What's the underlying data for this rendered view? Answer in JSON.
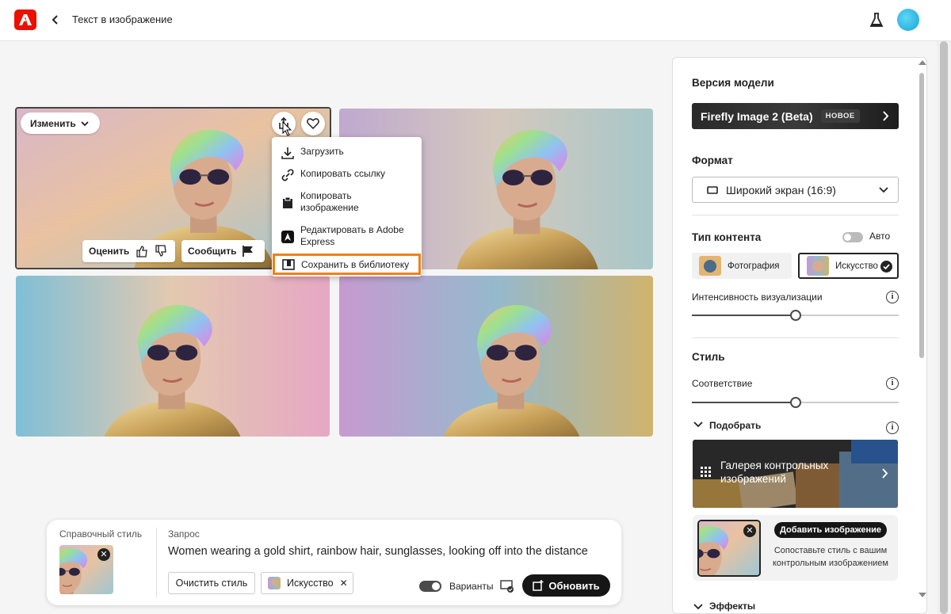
{
  "header": {
    "title": "Текст в изображение"
  },
  "image_actions": {
    "edit_label": "Изменить",
    "rate_label": "Оценить",
    "report_label": "Сообщить"
  },
  "share_menu": {
    "items": [
      {
        "label": "Загрузить",
        "icon": "download-icon"
      },
      {
        "label": "Копировать ссылку",
        "icon": "link-icon"
      },
      {
        "label": "Копировать изображение",
        "icon": "clipboard-icon"
      },
      {
        "label": "Редактировать в Adobe Express",
        "icon": "adobe-express-icon"
      },
      {
        "label": "Сохранить в библиотеку",
        "icon": "library-icon"
      }
    ]
  },
  "prompt_bar": {
    "ref_style_label": "Справочный стиль",
    "prompt_label": "Запрос",
    "prompt_text": "Women wearing a gold shirt, rainbow hair, sunglasses, looking off into the distance",
    "clear_style_label": "Очистить стиль",
    "tag_label": "Искусство",
    "variants_label": "Варианты",
    "update_label": "Обновить"
  },
  "panel": {
    "model_heading": "Версия модели",
    "model_name": "Firefly Image 2 (Beta)",
    "model_badge": "НОВОЕ",
    "format_heading": "Формат",
    "format_value": "Широкий экран (16:9)",
    "content_type_heading": "Тип контента",
    "auto_label": "Авто",
    "content_types": [
      "Фотография",
      "Искусство"
    ],
    "selected_content_type": "Искусство",
    "intensity_label": "Интенсивность визуализации",
    "intensity_value": 0.5,
    "style_heading": "Стиль",
    "match_label": "Соответствие",
    "match_value": 0.5,
    "pick_label": "Подобрать",
    "gallery_label": "Галерея контрольных изображений",
    "add_image_label": "Добавить изображение",
    "ref_description": "Сопоставьте стиль с вашим контрольным изображением",
    "effects_heading": "Эффекты"
  },
  "colors": {
    "adobe_red": "#eb1000",
    "highlight_orange": "#f08119",
    "primary_dark": "#161616"
  }
}
